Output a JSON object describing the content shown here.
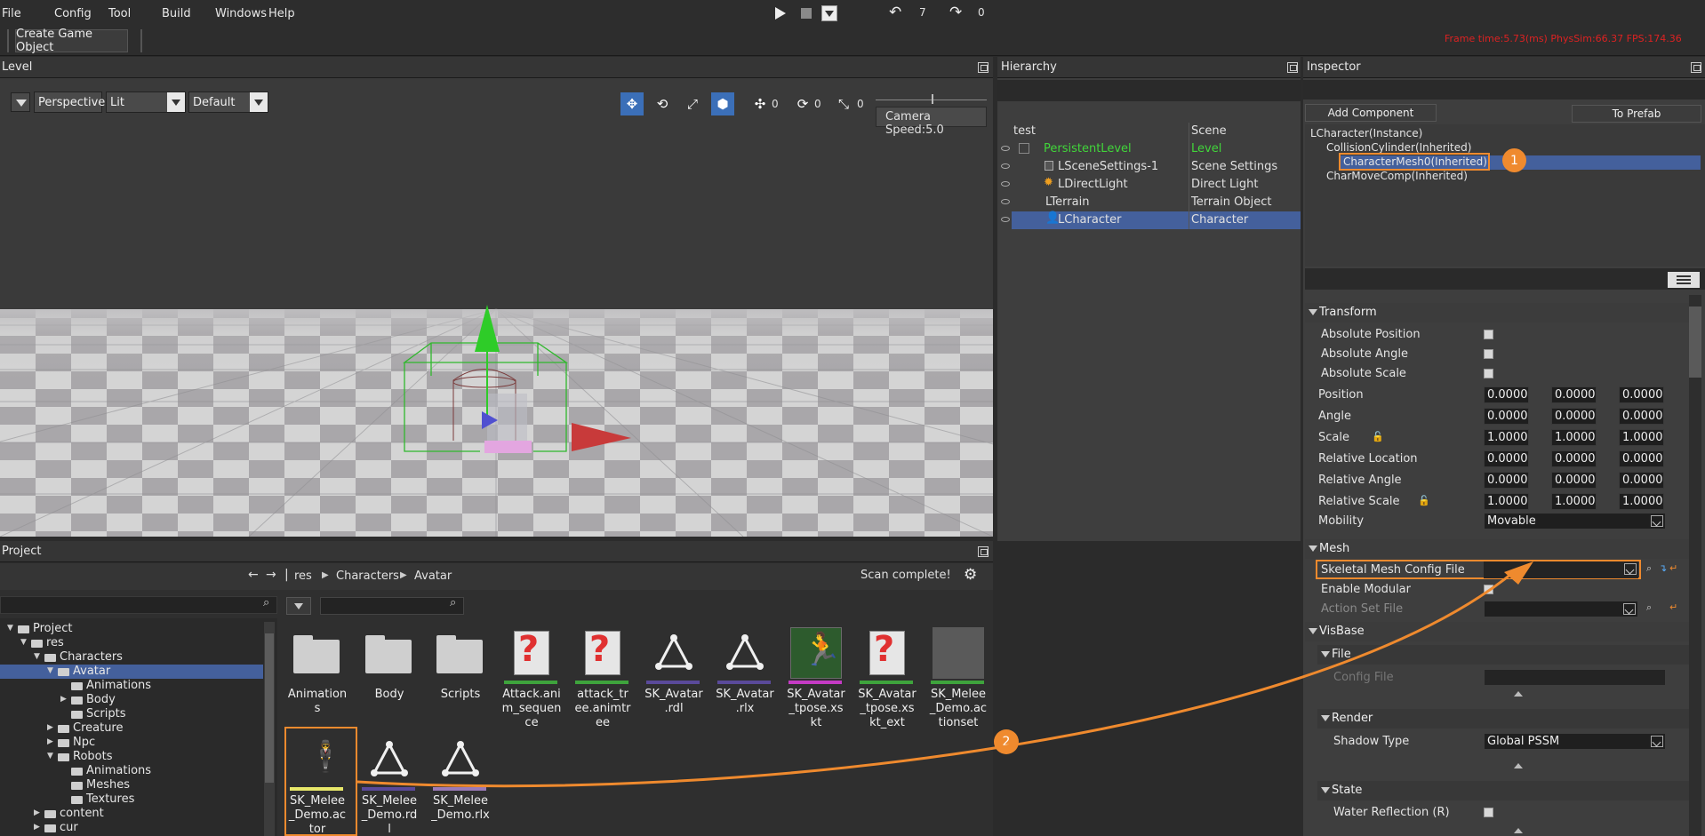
{
  "menu": [
    "File",
    "Config",
    "Tool",
    "Build",
    "Windows",
    "Help"
  ],
  "toolbar": {
    "undo_count": "7",
    "redo_count": "0",
    "create_button": "Create Game Object"
  },
  "status": "Frame time:5.73(ms)  PhysSim:66.37  FPS:174.36",
  "panels": {
    "level": "Level",
    "hierarchy": "Hierarchy",
    "inspector": "Inspector",
    "project": "Project"
  },
  "viewport": {
    "view_mode": "Perspective",
    "shading": "Lit",
    "preset": "Default",
    "move_count": "0",
    "rotate_count": "0",
    "scale_count": "0",
    "camera_speed": "Camera Speed:5.0"
  },
  "hierarchy": {
    "root": {
      "name": "test",
      "type": "Scene"
    },
    "rows": [
      {
        "name": "PersistentLevel",
        "type": "Level"
      },
      {
        "name": "LSceneSettings-1",
        "type": "Scene Settings"
      },
      {
        "name": "LDirectLight",
        "type": "Direct Light"
      },
      {
        "name": "LTerrain",
        "type": "Terrain Object"
      },
      {
        "name": "LCharacter",
        "type": "Character"
      }
    ]
  },
  "inspector": {
    "add_component": "Add Component",
    "to_prefab": "To Prefab",
    "components": [
      "LCharacter(Instance)",
      "CollisionCylinder(Inherited)",
      "CharacterMesh0(Inherited)",
      "CharMoveComp(Inherited)"
    ],
    "callout_1": "1",
    "callout_2": "2",
    "transform": {
      "title": "Transform",
      "absolute_position": "Absolute Position",
      "absolute_angle": "Absolute Angle",
      "absolute_scale": "Absolute Scale",
      "rows": [
        {
          "label": "Position",
          "values": [
            "0.0000",
            "0.0000",
            "0.0000"
          ]
        },
        {
          "label": "Angle",
          "values": [
            "0.0000",
            "0.0000",
            "0.0000"
          ]
        },
        {
          "label": "Scale",
          "values": [
            "1.0000",
            "1.0000",
            "1.0000"
          ]
        },
        {
          "label": "Relative Location",
          "values": [
            "0.0000",
            "0.0000",
            "0.0000"
          ]
        },
        {
          "label": "Relative Angle",
          "values": [
            "0.0000",
            "0.0000",
            "0.0000"
          ]
        },
        {
          "label": "Relative Scale",
          "values": [
            "1.0000",
            "1.0000",
            "1.0000"
          ]
        }
      ],
      "mobility_label": "Mobility",
      "mobility_value": "Movable"
    },
    "mesh": {
      "title": "Mesh",
      "skeletal_mesh_config": "Skeletal Mesh Config File",
      "enable_modular": "Enable Modular",
      "action_set": "Action Set File"
    },
    "visbase": {
      "title": "VisBase",
      "file_title": "File",
      "config_file": "Config File",
      "render_title": "Render",
      "shadow_type_label": "Shadow Type",
      "shadow_type_value": "Global PSSM",
      "state_title": "State",
      "water_reflection": "Water Reflection (R)"
    }
  },
  "project": {
    "breadcrumb": [
      "res",
      "Characters",
      "Avatar"
    ],
    "scan_status": "Scan complete!",
    "tree": [
      {
        "label": "Project",
        "depth": 0
      },
      {
        "label": "res",
        "depth": 1
      },
      {
        "label": "Characters",
        "depth": 2
      },
      {
        "label": "Avatar",
        "depth": 3
      },
      {
        "label": "Animations",
        "depth": 4
      },
      {
        "label": "Body",
        "depth": 4
      },
      {
        "label": "Scripts",
        "depth": 4
      },
      {
        "label": "Creature",
        "depth": 3
      },
      {
        "label": "Npc",
        "depth": 3
      },
      {
        "label": "Robots",
        "depth": 3
      },
      {
        "label": "Animations",
        "depth": 4
      },
      {
        "label": "Meshes",
        "depth": 4
      },
      {
        "label": "Textures",
        "depth": 4
      },
      {
        "label": "content",
        "depth": 2
      },
      {
        "label": "cur",
        "depth": 2
      }
    ],
    "assets": [
      {
        "name": "Animations",
        "kind": "folder"
      },
      {
        "name": "Body",
        "kind": "folder"
      },
      {
        "name": "Scripts",
        "kind": "folder"
      },
      {
        "name": "Attack.anim_sequence",
        "kind": "unknown"
      },
      {
        "name": "attack_tree.animtree",
        "kind": "unknown"
      },
      {
        "name": "SK_Avatar.rdl",
        "kind": "triangle"
      },
      {
        "name": "SK_Avatar.rlx",
        "kind": "triangle"
      },
      {
        "name": "SK_Avatar_tpose.xskt",
        "kind": "runner"
      },
      {
        "name": "SK_Avatar_tpose.xskt_ext",
        "kind": "unknown"
      },
      {
        "name": "SK_Melee_Demo.actionset",
        "kind": "blank"
      },
      {
        "name": "SK_Melee_Demo.actor",
        "kind": "actor"
      },
      {
        "name": "SK_Melee_Demo.rdl",
        "kind": "triangle"
      },
      {
        "name": "SK_Melee_Demo.rlx",
        "kind": "triangle"
      }
    ]
  },
  "colors": {
    "accent_orange": "#ef8a2e",
    "selection_blue": "#44609c",
    "green_text": "#41d63a"
  }
}
